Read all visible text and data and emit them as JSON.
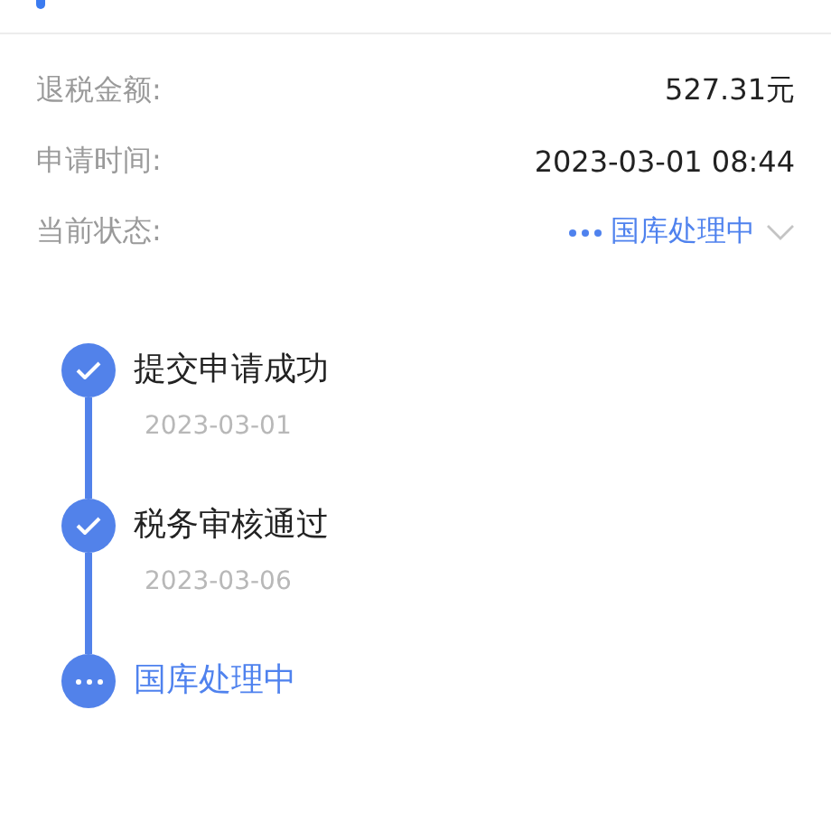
{
  "info_rows": [
    {
      "label": "退税金额:",
      "value": "527.31元",
      "kind": "text"
    },
    {
      "label": "申请时间:",
      "value": "2023-03-01 08:44",
      "kind": "text"
    },
    {
      "label": "当前状态:",
      "value": "国库处理中",
      "kind": "status"
    }
  ],
  "timeline": [
    {
      "title": "提交申请成功",
      "date": "2023-03-01",
      "kind": "done"
    },
    {
      "title": "税务审核通过",
      "date": "2023-03-06",
      "kind": "done"
    },
    {
      "title": "国库处理中",
      "kind": "current"
    }
  ]
}
